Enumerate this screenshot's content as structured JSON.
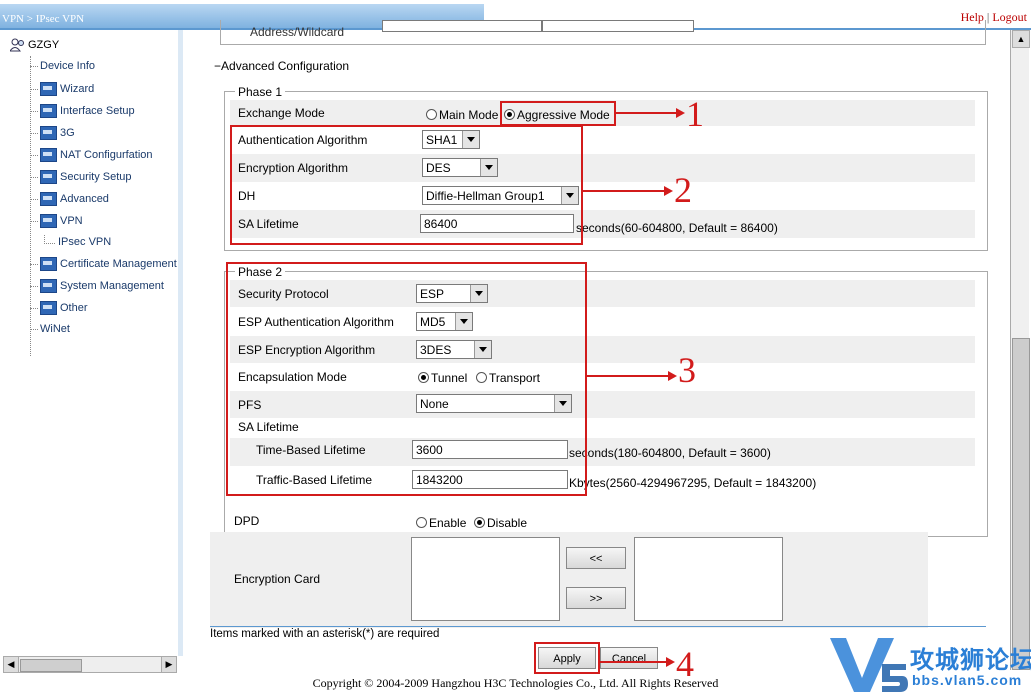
{
  "header": {
    "breadcrumb": "VPN > IPsec VPN",
    "help": "Help",
    "separator": "|",
    "logout": "Logout"
  },
  "sidebar": {
    "root": "GZGY",
    "items": [
      {
        "label": "Device Info"
      },
      {
        "label": "Wizard"
      },
      {
        "label": "Interface Setup"
      },
      {
        "label": "3G"
      },
      {
        "label": "NAT Configurfation"
      },
      {
        "label": "Security Setup"
      },
      {
        "label": "Advanced"
      },
      {
        "label": "VPN"
      },
      {
        "label": "IPsec VPN"
      },
      {
        "label": "Certificate Management"
      },
      {
        "label": "System Management"
      },
      {
        "label": "Other"
      },
      {
        "label": "WiNet"
      }
    ]
  },
  "main": {
    "address_wildcard_label": "Address/Wildcard",
    "advanced_toggle": "−",
    "advanced_title": "Advanced Configuration",
    "phase1": {
      "legend": "Phase 1",
      "exchange_mode_label": "Exchange Mode",
      "main_mode": "Main Mode",
      "aggressive_mode": "Aggressive Mode",
      "auth_label": "Authentication Algorithm",
      "auth_value": "SHA1",
      "enc_label": "Encryption Algorithm",
      "enc_value": "DES",
      "dh_label": "DH",
      "dh_value": "Diffie-Hellman Group1",
      "sa_label": "SA Lifetime",
      "sa_value": "86400",
      "sa_hint": "seconds(60-604800, Default = 86400)"
    },
    "phase2": {
      "legend": "Phase 2",
      "sec_proto_label": "Security Protocol",
      "sec_proto_value": "ESP",
      "esp_auth_label": "ESP Authentication Algorithm",
      "esp_auth_value": "MD5",
      "esp_enc_label": "ESP Encryption Algorithm",
      "esp_enc_value": "3DES",
      "encap_label": "Encapsulation Mode",
      "tunnel": "Tunnel",
      "transport": "Transport",
      "pfs_label": "PFS",
      "pfs_value": "None",
      "sa_label": "SA Lifetime",
      "time_label": "Time-Based Lifetime",
      "time_value": "3600",
      "time_hint": "seconds(180-604800, Default = 3600)",
      "traffic_label": "Traffic-Based Lifetime",
      "traffic_value": "1843200",
      "traffic_hint": "Kbytes(2560-4294967295, Default = 1843200)"
    },
    "dpd_label": "DPD",
    "dpd_enable": "Enable",
    "dpd_disable": "Disable",
    "enc_card_label": "Encryption Card",
    "move_left": "<<",
    "move_right": ">>",
    "required_note": "Items marked with an asterisk(*) are required",
    "apply": "Apply",
    "cancel": "Cancel"
  },
  "annotations": {
    "n1": "1",
    "n2": "2",
    "n3": "3",
    "n4": "4"
  },
  "footer": "Copyright © 2004-2009 Hangzhou H3C Technologies Co., Ltd. All Rights Reserved",
  "watermark": {
    "brand": "攻城狮论坛",
    "url": "bbs.vlan5.com"
  },
  "colors": {
    "annotation_red": "#d21b1b",
    "header_blue": "#7fb2e0",
    "watermark_blue": "#2b7fd6"
  }
}
